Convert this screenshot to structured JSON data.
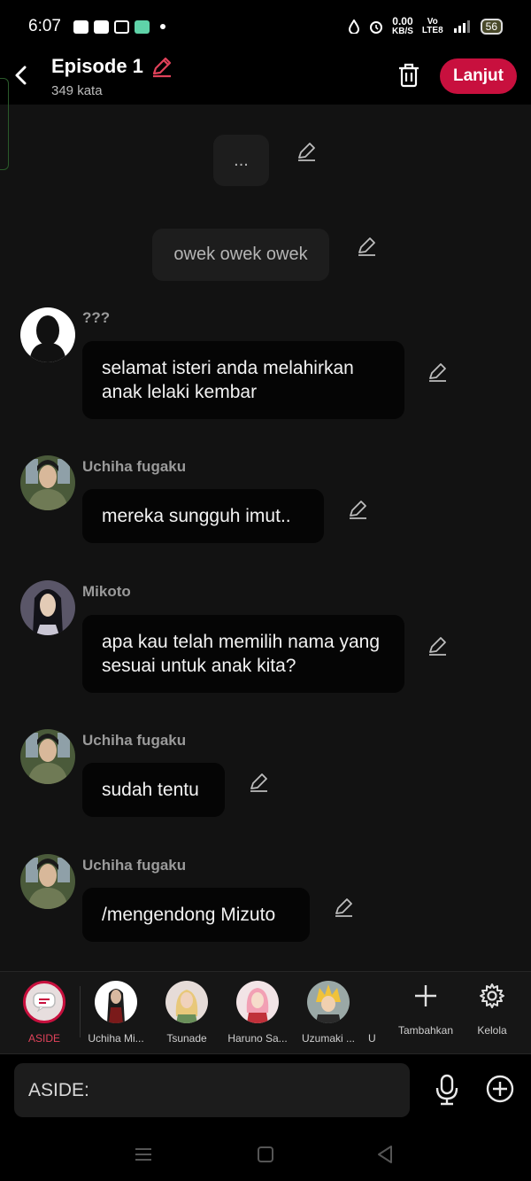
{
  "status": {
    "time": "6:07",
    "net_speed_top": "0.00",
    "net_speed_unit": "KB/S",
    "lte_top": "Vo",
    "lte_bottom": "LTE8",
    "battery": "56"
  },
  "header": {
    "title": "Episode 1",
    "word_count": "349 kata",
    "next_label": "Lanjut"
  },
  "messages": {
    "aside1": "...",
    "aside2": "owek owek owek",
    "m1": {
      "name": "???",
      "text": "selamat isteri anda melahirkan anak lelaki kembar"
    },
    "m2": {
      "name": "Uchiha fugaku",
      "text": "mereka sungguh imut.."
    },
    "m3": {
      "name": "Mikoto",
      "text": "apa kau telah memilih nama yang sesuai untuk anak kita?"
    },
    "m4": {
      "name": "Uchiha fugaku",
      "text": "sudah tentu"
    },
    "m5": {
      "name": "Uchiha fugaku",
      "text": "/mengendong Mizuto"
    }
  },
  "characters": [
    {
      "label": "ASIDE"
    },
    {
      "label": "Uchiha Mi..."
    },
    {
      "label": "Tsunade"
    },
    {
      "label": "Haruno Sa..."
    },
    {
      "label": "Uzumaki ..."
    },
    {
      "label": "U"
    }
  ],
  "tools": {
    "add_label": "Tambahkan",
    "manage_label": "Kelola"
  },
  "input": {
    "value": "ASIDE:"
  },
  "colors": {
    "accent": "#c8103e",
    "active_label": "#e0425a",
    "background": "#121212"
  }
}
